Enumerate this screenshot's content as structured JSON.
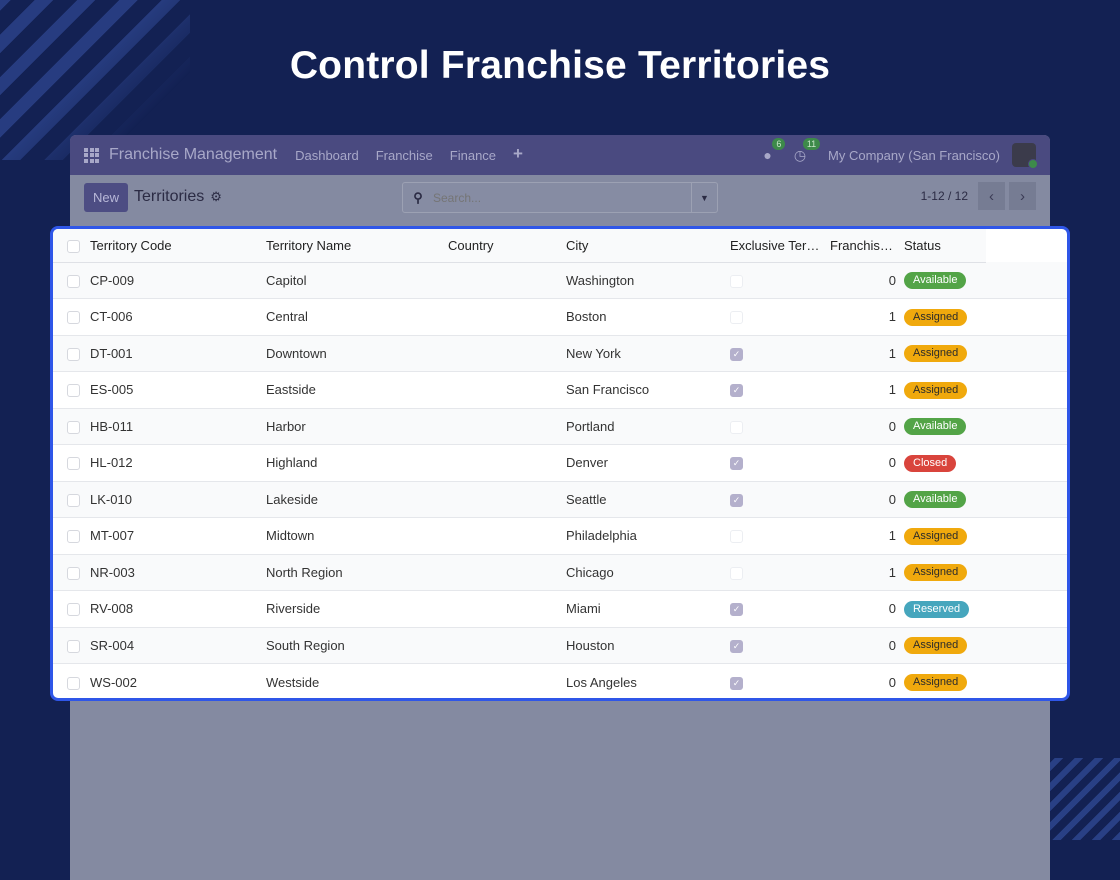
{
  "hero": {
    "title": "Control Franchise Territories"
  },
  "navbar": {
    "brand": "Franchise Management",
    "items": [
      "Dashboard",
      "Franchise",
      "Finance"
    ],
    "plus": "+",
    "messages_count": "6",
    "activities_count": "11",
    "company": "My Company (San Francisco)"
  },
  "control": {
    "new_label": "New",
    "breadcrumb": "Territories",
    "search_placeholder": "Search...",
    "pager": "1-12 / 12"
  },
  "columns": [
    "Territory Code",
    "Territory Name",
    "Country",
    "City",
    "Exclusive Ter…",
    "Franchis…",
    "Status"
  ],
  "rows": [
    {
      "code": "CP-009",
      "name": "Capitol",
      "country": "",
      "city": "Washington",
      "exclusive": false,
      "franchises": "0",
      "status": "Available"
    },
    {
      "code": "CT-006",
      "name": "Central",
      "country": "",
      "city": "Boston",
      "exclusive": false,
      "franchises": "1",
      "status": "Assigned"
    },
    {
      "code": "DT-001",
      "name": "Downtown",
      "country": "",
      "city": "New York",
      "exclusive": true,
      "franchises": "1",
      "status": "Assigned"
    },
    {
      "code": "ES-005",
      "name": "Eastside",
      "country": "",
      "city": "San Francisco",
      "exclusive": true,
      "franchises": "1",
      "status": "Assigned"
    },
    {
      "code": "HB-011",
      "name": "Harbor",
      "country": "",
      "city": "Portland",
      "exclusive": false,
      "franchises": "0",
      "status": "Available"
    },
    {
      "code": "HL-012",
      "name": "Highland",
      "country": "",
      "city": "Denver",
      "exclusive": true,
      "franchises": "0",
      "status": "Closed"
    },
    {
      "code": "LK-010",
      "name": "Lakeside",
      "country": "",
      "city": "Seattle",
      "exclusive": true,
      "franchises": "0",
      "status": "Available"
    },
    {
      "code": "MT-007",
      "name": "Midtown",
      "country": "",
      "city": "Philadelphia",
      "exclusive": false,
      "franchises": "1",
      "status": "Assigned"
    },
    {
      "code": "NR-003",
      "name": "North Region",
      "country": "",
      "city": "Chicago",
      "exclusive": false,
      "franchises": "1",
      "status": "Assigned"
    },
    {
      "code": "RV-008",
      "name": "Riverside",
      "country": "",
      "city": "Miami",
      "exclusive": true,
      "franchises": "0",
      "status": "Reserved"
    },
    {
      "code": "SR-004",
      "name": "South Region",
      "country": "",
      "city": "Houston",
      "exclusive": true,
      "franchises": "0",
      "status": "Assigned"
    },
    {
      "code": "WS-002",
      "name": "Westside",
      "country": "",
      "city": "Los Angeles",
      "exclusive": true,
      "franchises": "0",
      "status": "Assigned"
    }
  ],
  "status_colors": {
    "Available": "#53a447",
    "Assigned": "#f0a90d",
    "Closed": "#d9443c",
    "Reserved": "#46a6bd"
  }
}
